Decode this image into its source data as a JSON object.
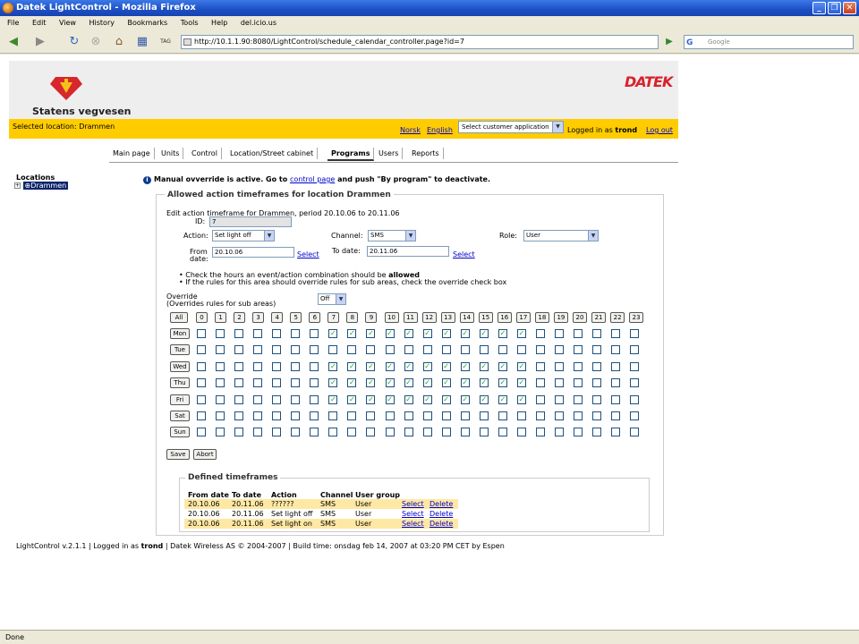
{
  "window": {
    "title": "Datek LightControl - Mozilla Firefox",
    "buttons": [
      "_",
      "❐",
      "✕"
    ]
  },
  "menu": [
    "File",
    "Edit",
    "View",
    "History",
    "Bookmarks",
    "Tools",
    "Help",
    "del.icio.us"
  ],
  "nav": {
    "url": "http://10.1.1.90:8080/LightControl/schedule_calendar_controller.page?id=7",
    "search_placeholder": "Google",
    "tag_label": "TAG"
  },
  "header": {
    "brand": "Statens vegvesen",
    "partner_logo": "DATEK",
    "selected_location": "Selected location: Drammen",
    "lang_norsk": "Norsk",
    "lang_english": "English",
    "customer_select": "Select customer application",
    "logged_in_prefix": "Logged in as",
    "logged_in_user": "trond",
    "logout": "Log out"
  },
  "tabs": [
    {
      "label": "Main page",
      "active": false
    },
    {
      "label": "Units",
      "active": false
    },
    {
      "label": "Control",
      "active": false
    },
    {
      "label": "Location/Street cabinet",
      "active": false
    },
    {
      "label": "Programs",
      "active": true
    },
    {
      "label": "Users",
      "active": false
    },
    {
      "label": "Reports",
      "active": false
    }
  ],
  "sidebar": {
    "title": "Locations",
    "tree_item": "Drammen"
  },
  "notice": {
    "before": "Manual ovverride is active. Go to",
    "link": "control page",
    "after": "and push \"By program\" to deactivate."
  },
  "form": {
    "legend": "Allowed action timeframes for location Drammen",
    "subtitle": "Edit action timeframe for Drammen, period 20.10.06 to 20.11.06",
    "id_label": "ID:",
    "id_value": "7",
    "action_label": "Action:",
    "action_value": "Set light off",
    "channel_label": "Channel:",
    "channel_value": "SMS",
    "role_label": "Role:",
    "role_value": "User",
    "from_label": "From",
    "from_label2": "date:",
    "from_value": "20.10.06",
    "to_label": "To date:",
    "to_value": "20.11.06",
    "select_link": "Select",
    "bullet1_pre": "Check the hours an event/action combination should be",
    "bullet1_bold": "allowed",
    "bullet2": "If the rules for this area should override rules for sub areas, check the override check box",
    "override_label": "Override",
    "override_sub": "(Overrides rules for sub areas)",
    "override_value": "Off",
    "all_button": "All",
    "save_button": "Save",
    "abort_button": "Abort"
  },
  "schedule": {
    "hours": [
      "0",
      "1",
      "2",
      "3",
      "4",
      "5",
      "6",
      "7",
      "8",
      "9",
      "10",
      "11",
      "12",
      "13",
      "14",
      "15",
      "16",
      "17",
      "18",
      "19",
      "20",
      "21",
      "22",
      "23"
    ],
    "days": [
      {
        "label": "Mon",
        "checked": [
          7,
          8,
          9,
          10,
          11,
          12,
          13,
          14,
          15,
          16,
          17
        ]
      },
      {
        "label": "Tue",
        "checked": []
      },
      {
        "label": "Wed",
        "checked": [
          7,
          8,
          9,
          10,
          11,
          12,
          13,
          14,
          15,
          16,
          17
        ]
      },
      {
        "label": "Thu",
        "checked": [
          7,
          8,
          9,
          10,
          11,
          12,
          13,
          14,
          15,
          16,
          17
        ]
      },
      {
        "label": "Fri",
        "checked": [
          7,
          8,
          9,
          10,
          11,
          12,
          13,
          14,
          15,
          16,
          17
        ]
      },
      {
        "label": "Sat",
        "checked": []
      },
      {
        "label": "Sun",
        "checked": []
      }
    ]
  },
  "timeframes": {
    "legend": "Defined timeframes",
    "headers": [
      "From date",
      "To date",
      "Action",
      "Channel",
      "User group"
    ],
    "rows": [
      {
        "from": "20.10.06",
        "to": "20.11.06",
        "action": "??????",
        "channel": "SMS",
        "group": "User",
        "select": "Select",
        "delete": "Delete"
      },
      {
        "from": "20.10.06",
        "to": "20.11.06",
        "action": "Set light off",
        "channel": "SMS",
        "group": "User",
        "select": "Select",
        "delete": "Delete"
      },
      {
        "from": "20.10.06",
        "to": "20.11.06",
        "action": "Set light on",
        "channel": "SMS",
        "group": "User",
        "select": "Select",
        "delete": "Delete"
      }
    ]
  },
  "footer": {
    "before": "LightControl v.2.1.1  | Logged in as",
    "user": "trond",
    "after": "| Datek Wireless AS  © 2004-2007 | Build time: onsdag feb 14, 2007 at 03:20 PM CET by Espen"
  },
  "status": "Done"
}
